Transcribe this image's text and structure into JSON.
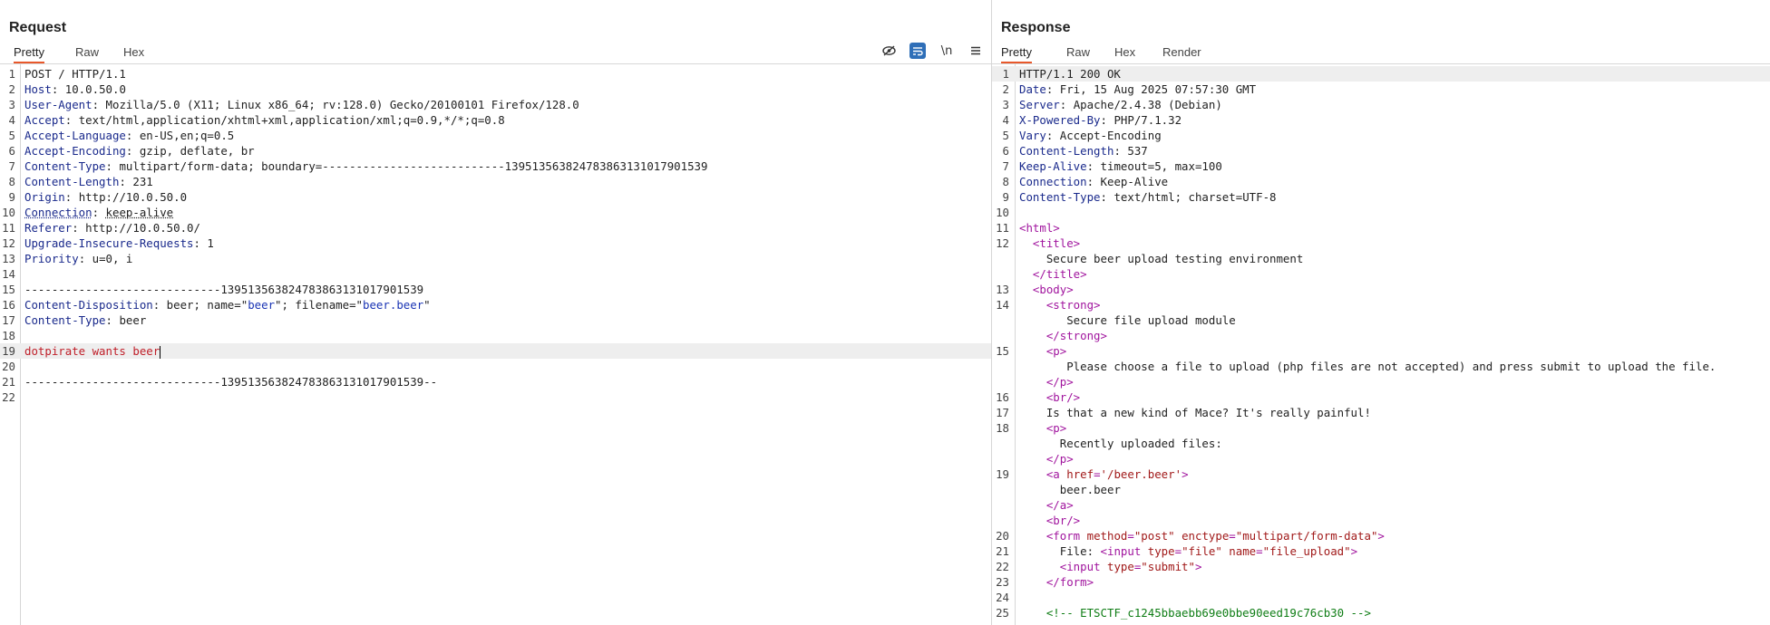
{
  "request": {
    "title": "Request",
    "tabs": [
      "Pretty",
      "Raw",
      "Hex"
    ],
    "active_tab": "Pretty",
    "toolbar": [
      "eye-off-icon",
      "wrap-icon",
      "newline-toggle",
      "menu-icon"
    ],
    "newline_label": "\\n",
    "lines": [
      {
        "n": "1",
        "text": "POST / HTTP/1.1"
      },
      {
        "n": "2",
        "key": "Host",
        "val": "10.0.50.0"
      },
      {
        "n": "3",
        "key": "User-Agent",
        "val": "Mozilla/5.0 (X11; Linux x86_64; rv:128.0) Gecko/20100101 Firefox/128.0"
      },
      {
        "n": "4",
        "key": "Accept",
        "val": "text/html,application/xhtml+xml,application/xml;q=0.9,*/*;q=0.8"
      },
      {
        "n": "5",
        "key": "Accept-Language",
        "val": "en-US,en;q=0.5"
      },
      {
        "n": "6",
        "key": "Accept-Encoding",
        "val": "gzip, deflate, br"
      },
      {
        "n": "7",
        "key": "Content-Type",
        "val": "multipart/form-data; boundary=---------------------------139513563824783863131017901539"
      },
      {
        "n": "8",
        "key": "Content-Length",
        "val": "231"
      },
      {
        "n": "9",
        "key": "Origin",
        "val": "http://10.0.50.0"
      },
      {
        "n": "10",
        "key": "Connection",
        "val": "keep-alive"
      },
      {
        "n": "11",
        "key": "Referer",
        "val": "http://10.0.50.0/"
      },
      {
        "n": "12",
        "key": "Upgrade-Insecure-Requests",
        "val": "1"
      },
      {
        "n": "13",
        "key": "Priority",
        "val": "u=0, i"
      },
      {
        "n": "14",
        "text": ""
      },
      {
        "n": "15",
        "text": "-----------------------------139513563824783863131017901539"
      },
      {
        "n": "16",
        "disposition": {
          "key": "Content-Disposition",
          "a": "beer; name=\"",
          "b": "beer",
          "c": "\"; filename=\"",
          "d": "beer.beer",
          "e": "\""
        }
      },
      {
        "n": "17",
        "key": "Content-Type",
        "val": "beer"
      },
      {
        "n": "18",
        "text": ""
      },
      {
        "n": "19",
        "body": "dotpirate wants beer"
      },
      {
        "n": "20",
        "text": ""
      },
      {
        "n": "21",
        "text": "-----------------------------139513563824783863131017901539--"
      },
      {
        "n": "22",
        "text": ""
      }
    ]
  },
  "response": {
    "title": "Response",
    "tabs": [
      "Pretty",
      "Raw",
      "Hex",
      "Render"
    ],
    "active_tab": "Pretty",
    "lines": [
      {
        "n": "1",
        "text": "HTTP/1.1 200 OK"
      },
      {
        "n": "2",
        "key": "Date",
        "val": "Fri, 15 Aug 2025 07:57:30 GMT"
      },
      {
        "n": "3",
        "key": "Server",
        "val": "Apache/2.4.38 (Debian)"
      },
      {
        "n": "4",
        "key": "X-Powered-By",
        "val": "PHP/7.1.32"
      },
      {
        "n": "5",
        "key": "Vary",
        "val": "Accept-Encoding"
      },
      {
        "n": "6",
        "key": "Content-Length",
        "val": "537"
      },
      {
        "n": "7",
        "key": "Keep-Alive",
        "val": "timeout=5, max=100"
      },
      {
        "n": "8",
        "key": "Connection",
        "val": "Keep-Alive"
      },
      {
        "n": "9",
        "key": "Content-Type",
        "val": "text/html; charset=UTF-8"
      },
      {
        "n": "10",
        "html": []
      },
      {
        "n": "11",
        "html": [
          [
            "tag",
            "<html>"
          ]
        ]
      },
      {
        "n": "12",
        "html": [
          [
            "sp",
            "  "
          ],
          [
            "tag",
            "<title>"
          ]
        ]
      },
      {
        "n": "",
        "html": [
          [
            "sp",
            "    "
          ],
          [
            "txt",
            "Secure beer upload testing environment"
          ]
        ]
      },
      {
        "n": "",
        "html": [
          [
            "sp",
            "  "
          ],
          [
            "tag",
            "</title>"
          ]
        ]
      },
      {
        "n": "13",
        "html": [
          [
            "sp",
            "  "
          ],
          [
            "tag",
            "<body>"
          ]
        ]
      },
      {
        "n": "14",
        "html": [
          [
            "sp",
            "    "
          ],
          [
            "tag",
            "<strong>"
          ]
        ]
      },
      {
        "n": "",
        "html": [
          [
            "sp",
            "       "
          ],
          [
            "txt",
            "Secure file upload module"
          ]
        ]
      },
      {
        "n": "",
        "html": [
          [
            "sp",
            "    "
          ],
          [
            "tag",
            "</strong>"
          ]
        ]
      },
      {
        "n": "15",
        "html": [
          [
            "sp",
            "    "
          ],
          [
            "tag",
            "<p>"
          ]
        ]
      },
      {
        "n": "",
        "html": [
          [
            "sp",
            "       "
          ],
          [
            "txt",
            "Please choose a file to upload (php files are not accepted) and press submit to upload the file."
          ]
        ]
      },
      {
        "n": "",
        "html": [
          [
            "sp",
            "    "
          ],
          [
            "tag",
            "</p>"
          ]
        ]
      },
      {
        "n": "16",
        "html": [
          [
            "sp",
            "    "
          ],
          [
            "tag",
            "<br/>"
          ]
        ]
      },
      {
        "n": "17",
        "html": [
          [
            "sp",
            "    "
          ],
          [
            "txt",
            "Is that a new kind of Mace? It's really painful!"
          ]
        ]
      },
      {
        "n": "18",
        "html": [
          [
            "sp",
            "    "
          ],
          [
            "tag",
            "<p>"
          ]
        ]
      },
      {
        "n": "",
        "html": [
          [
            "sp",
            "      "
          ],
          [
            "txt",
            "Recently uploaded files:"
          ]
        ]
      },
      {
        "n": "",
        "html": [
          [
            "sp",
            "    "
          ],
          [
            "tag",
            "</p>"
          ]
        ]
      },
      {
        "n": "19",
        "html": [
          [
            "sp",
            "    "
          ],
          [
            "tag",
            "<a "
          ],
          [
            "attr",
            "href"
          ],
          [
            "tag",
            "="
          ],
          [
            "val",
            "'/beer.beer'"
          ],
          [
            "tag",
            ">"
          ]
        ]
      },
      {
        "n": "",
        "html": [
          [
            "sp",
            "      "
          ],
          [
            "txt",
            "beer.beer"
          ]
        ]
      },
      {
        "n": "",
        "html": [
          [
            "sp",
            "    "
          ],
          [
            "tag",
            "</a>"
          ]
        ]
      },
      {
        "n": "",
        "html": [
          [
            "sp",
            "    "
          ],
          [
            "tag",
            "<br/>"
          ]
        ]
      },
      {
        "n": "20",
        "html": [
          [
            "sp",
            "    "
          ],
          [
            "tag",
            "<form "
          ],
          [
            "attr",
            "method"
          ],
          [
            "tag",
            "="
          ],
          [
            "val",
            "\"post\""
          ],
          [
            "tag",
            " "
          ],
          [
            "attr",
            "enctype"
          ],
          [
            "tag",
            "="
          ],
          [
            "val",
            "\"multipart/form-data\""
          ],
          [
            "tag",
            ">"
          ]
        ]
      },
      {
        "n": "21",
        "html": [
          [
            "sp",
            "      "
          ],
          [
            "txt",
            "File: "
          ],
          [
            "tag",
            "<input "
          ],
          [
            "attr",
            "type"
          ],
          [
            "tag",
            "="
          ],
          [
            "val",
            "\"file\""
          ],
          [
            "tag",
            " "
          ],
          [
            "attr",
            "name"
          ],
          [
            "tag",
            "="
          ],
          [
            "val",
            "\"file_upload\""
          ],
          [
            "tag",
            ">"
          ]
        ]
      },
      {
        "n": "22",
        "html": [
          [
            "sp",
            "      "
          ],
          [
            "tag",
            "<input "
          ],
          [
            "attr",
            "type"
          ],
          [
            "tag",
            "="
          ],
          [
            "val",
            "\"submit\""
          ],
          [
            "tag",
            ">"
          ]
        ]
      },
      {
        "n": "23",
        "html": [
          [
            "sp",
            "    "
          ],
          [
            "tag",
            "</form>"
          ]
        ]
      },
      {
        "n": "24",
        "html": []
      },
      {
        "n": "25",
        "html": [
          [
            "sp",
            "    "
          ],
          [
            "com",
            "<!-- ETSCTF_c1245bbaebb69e0bbe90eed19c76cb30 -->"
          ]
        ]
      }
    ]
  }
}
